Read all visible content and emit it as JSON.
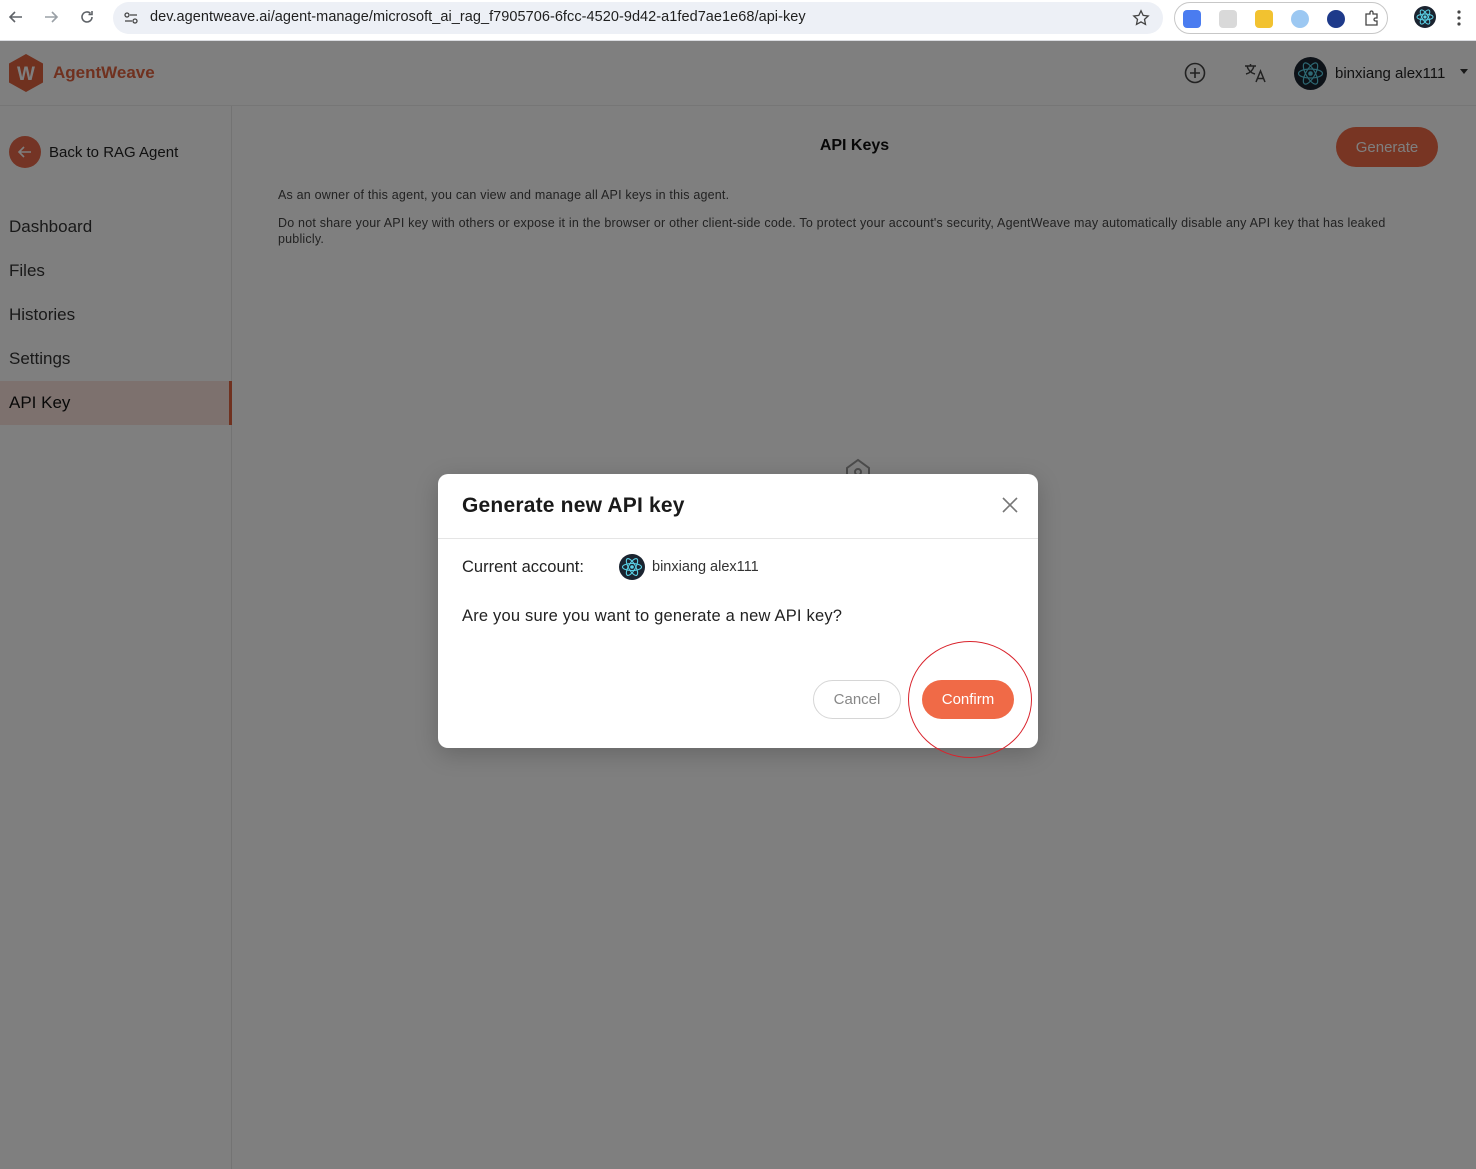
{
  "browser": {
    "url": "dev.agentweave.ai/agent-manage/microsoft_ai_rag_f7905706-6fcc-4520-9d42-a1fed7ae1e68/api-key"
  },
  "header": {
    "brand": "AgentWeave",
    "logo_letter": "W",
    "user_name": "binxiang alex111",
    "brand_color": "#e0623e"
  },
  "sidebar": {
    "back_label": "Back to RAG Agent",
    "items": [
      {
        "label": "Dashboard"
      },
      {
        "label": "Files"
      },
      {
        "label": "Histories"
      },
      {
        "label": "Settings"
      },
      {
        "label": "API Key",
        "active": true
      }
    ]
  },
  "main": {
    "title": "API Keys",
    "generate_label": "Generate",
    "desc1": "As an owner of this agent, you can view and manage all API keys in this agent.",
    "desc2": "Do not share your API key with others or expose it in the browser or other client-side code. To protect your account's security, AgentWeave may automatically disable any API key that has leaked publicly."
  },
  "modal": {
    "title": "Generate new API key",
    "account_label": "Current account:",
    "account_name": "binxiang alex111",
    "question": "Are you sure you want to generate a new API key?",
    "cancel_label": "Cancel",
    "confirm_label": "Confirm",
    "accent_color": "#f06a47"
  }
}
